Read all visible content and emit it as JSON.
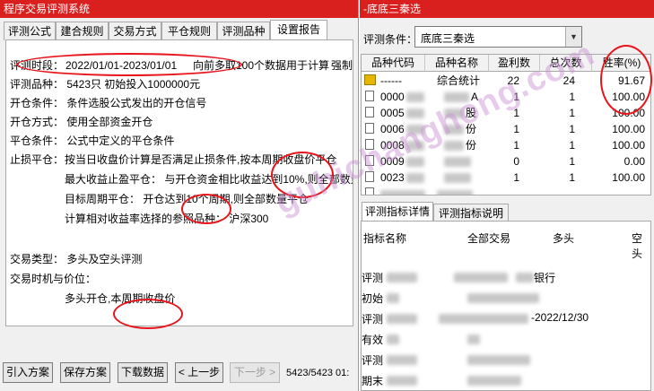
{
  "left_window": {
    "title": "程序交易评测系统",
    "tabs": [
      "评测公式",
      "建合规则",
      "交易方式",
      "平仓规则",
      "评测品种",
      "设置报告"
    ],
    "active_tab": 5,
    "report": {
      "time_label": "评测时段：",
      "time_range": "2022/01/01-2023/01/01",
      "time_note": "向前多取100个数据用于计算",
      "time_extra": "强制平",
      "variety": "评测品种：  5423只 初始投入1000000元",
      "open_cond": "开仓条件：  条件选股公式发出的开仓信号",
      "open_mode": "开仓方式：  使用全部资金开仓",
      "close_cond": "平仓条件：  公式中定义的平仓条件",
      "stop_label": "止损平仓：",
      "stop_1": "按当日收盘价计算是否满足止损条件,按本周期收盘价平仓",
      "stop_2": "最大收益止盈平仓：  与开仓资金相比收益达到10%,则全部数量平",
      "stop_3": "目标周期平仓：  开仓达到10个周期,则全部数量平仓",
      "stop_4": "计算相对收益率选择的参照品种：  沪深300",
      "trade_type": "交易类型：  多头及空头评测",
      "trade_timing": "交易时机与价位：",
      "trade_timing_detail": "多头开仓,本周期收盘价"
    },
    "buttons": {
      "import": "引入方案",
      "save": "保存方案",
      "download": "下载数据",
      "prev": "< 上一步",
      "next": "下一步 >"
    },
    "status": "5423/5423 01:"
  },
  "right_window": {
    "title": "-底底三秦选",
    "condition_label": "评测条件：",
    "condition_value": "底底三秦选",
    "columns": [
      "品种代码",
      "品种名称",
      "盈利数",
      "总次数",
      "胜率(%)"
    ],
    "rows": [
      {
        "code": "------",
        "name": "综合统计",
        "wins": "22",
        "total": "24",
        "rate": "91.67"
      },
      {
        "code": "0000",
        "name": "A",
        "wins": "1",
        "total": "1",
        "rate": "100.00"
      },
      {
        "code": "0005",
        "name": "股",
        "wins": "1",
        "total": "1",
        "rate": "100.00"
      },
      {
        "code": "0006",
        "name": "份",
        "wins": "1",
        "total": "1",
        "rate": "100.00"
      },
      {
        "code": "0008",
        "name": "份",
        "wins": "1",
        "total": "1",
        "rate": "100.00"
      },
      {
        "code": "0009",
        "name": "",
        "wins": "0",
        "total": "1",
        "rate": "0.00"
      },
      {
        "code": "0023",
        "name": "",
        "wins": "1",
        "total": "1",
        "rate": "100.00"
      }
    ],
    "bottom_tabs": [
      "评测指标详情",
      "评测指标说明"
    ],
    "detail_headers": [
      "指标名称",
      "全部交易",
      "多头",
      "空头"
    ],
    "detail_rows": [
      {
        "label": "评测",
        "value": "银行"
      },
      {
        "label": "初始",
        "value": ""
      },
      {
        "label": "评测",
        "value": "-2022/12/30"
      },
      {
        "label": "有效",
        "value": ""
      },
      {
        "label": "评测",
        "value": ""
      },
      {
        "label": "期末",
        "value": ""
      }
    ]
  },
  "watermark": "guhichanghong.com"
}
